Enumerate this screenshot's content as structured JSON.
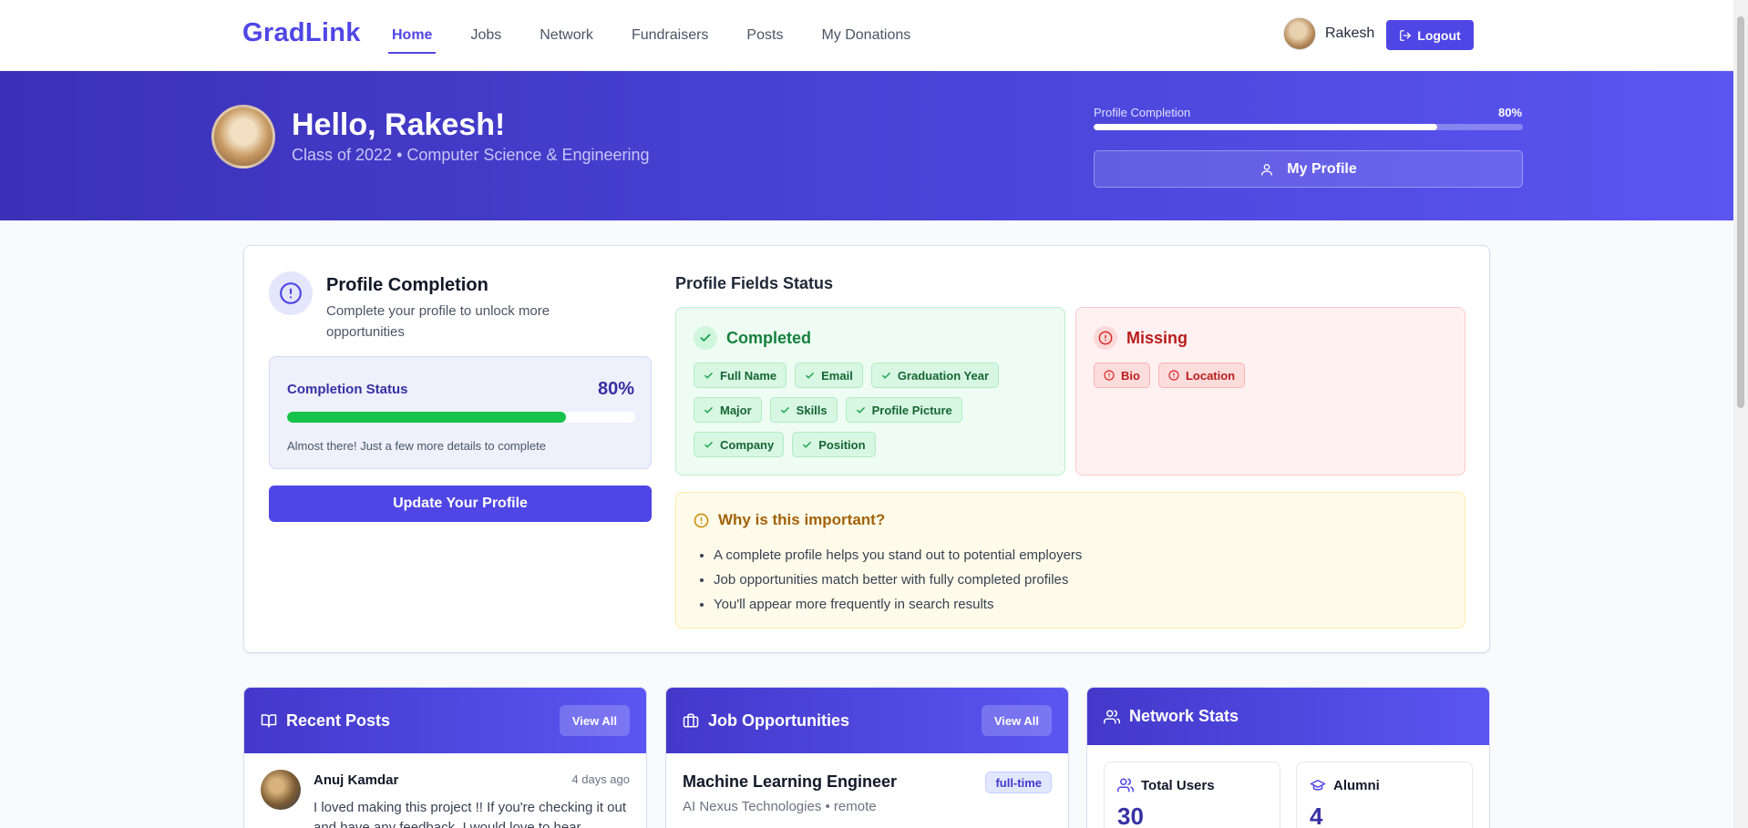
{
  "nav": {
    "brand": "GradLink",
    "links": [
      "Home",
      "Jobs",
      "Network",
      "Fundraisers",
      "Posts",
      "My Donations"
    ],
    "active": "Home",
    "username": "Rakesh",
    "logout_label": "Logout"
  },
  "hero": {
    "greeting": "Hello, Rakesh!",
    "class_line": "Class of 2022 • Computer Science & Engineering",
    "progress_label": "Profile Completion",
    "progress_pct_text": "80%",
    "progress_value": 0.8,
    "my_profile_label": "My Profile"
  },
  "profile_card": {
    "title": "Profile Completion",
    "subtitle": "Complete your profile to unlock more opportunities",
    "status_label": "Completion Status",
    "status_pct_text": "80%",
    "status_value": 0.8,
    "status_note": "Almost there! Just a few more details to complete",
    "update_label": "Update Your Profile",
    "fields_title": "Profile Fields Status",
    "completed_title": "Completed",
    "completed_fields": [
      "Full Name",
      "Email",
      "Graduation Year",
      "Major",
      "Skills",
      "Profile Picture",
      "Company",
      "Position"
    ],
    "missing_title": "Missing",
    "missing_fields": [
      "Bio",
      "Location"
    ],
    "why_title": "Why is this important?",
    "why_points": [
      "A complete profile helps you stand out to potential employers",
      "Job opportunities match better with fully completed profiles",
      "You'll appear more frequently in search results"
    ]
  },
  "recent_posts": {
    "title": "Recent Posts",
    "view_all": "View All",
    "post": {
      "author": "Anuj Kamdar",
      "time": "4 days ago",
      "text": "I loved making this project !! If you're checking it out and have any feedback, I would love to hear"
    }
  },
  "jobs": {
    "title": "Job Opportunities",
    "view_all": "View All",
    "job": {
      "title": "Machine Learning Engineer",
      "company_line": "AI Nexus Technologies • remote",
      "badge": "full-time"
    }
  },
  "network": {
    "title": "Network Stats",
    "total_users_label": "Total Users",
    "total_users": "30",
    "alumni_label": "Alumni",
    "alumni": "4"
  },
  "colors": {
    "accent": "#4f46e5",
    "success": "#16c24b",
    "danger": "#b91c1c",
    "warning": "#a16207"
  }
}
